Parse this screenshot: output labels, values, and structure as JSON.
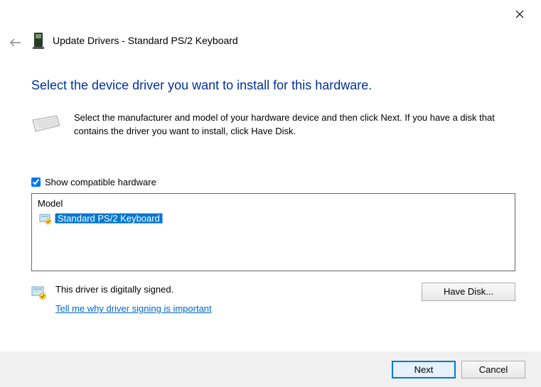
{
  "window": {
    "title": "Update Drivers - Standard PS/2 Keyboard"
  },
  "heading": "Select the device driver you want to install for this hardware.",
  "instruction": "Select the manufacturer and model of your hardware device and then click Next. If you have a disk that contains the driver you want to install, click Have Disk.",
  "checkbox": {
    "label": "Show compatible hardware",
    "checked": true
  },
  "model_list": {
    "header": "Model",
    "items": [
      {
        "label": "Standard PS/2 Keyboard",
        "selected": true
      }
    ]
  },
  "signing": {
    "signed_text": "This driver is digitally signed.",
    "link_text": "Tell me why driver signing is important"
  },
  "buttons": {
    "have_disk": "Have Disk...",
    "next": "Next",
    "cancel": "Cancel"
  }
}
